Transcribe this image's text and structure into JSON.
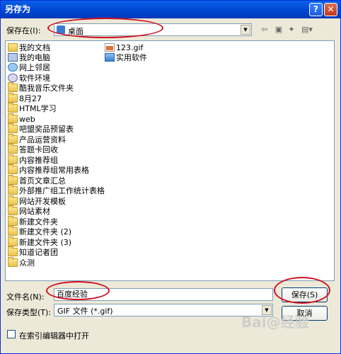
{
  "window": {
    "title": "另存为",
    "help_glyph": "?",
    "close_glyph": "✕"
  },
  "save_in": {
    "label": "保存在(I):",
    "value": "桌面"
  },
  "toolbar": {
    "back_icon": "back-arrow-icon",
    "up_icon": "up-folder-icon",
    "new_icon": "new-folder-icon",
    "views_icon": "views-menu-icon"
  },
  "files": [
    {
      "name": "我的文档",
      "icon": "documents-icon"
    },
    {
      "name": "我的电脑",
      "icon": "computer-icon"
    },
    {
      "name": "网上邻居",
      "icon": "network-icon"
    },
    {
      "name": "软件环境",
      "icon": "software-icon"
    },
    {
      "name": "酷我音乐文件夹",
      "icon": "folder-icon"
    },
    {
      "name": "8月27",
      "icon": "folder-icon"
    },
    {
      "name": "HTML学习",
      "icon": "folder-icon"
    },
    {
      "name": "web",
      "icon": "folder-icon"
    },
    {
      "name": "吧盟奖品预留表",
      "icon": "folder-icon"
    },
    {
      "name": "产品运营资料",
      "icon": "folder-icon"
    },
    {
      "name": "答题卡回收",
      "icon": "folder-icon"
    },
    {
      "name": "内容推荐组",
      "icon": "folder-icon"
    },
    {
      "name": "内容推荐组常用表格",
      "icon": "folder-icon"
    },
    {
      "name": "首页文章汇总",
      "icon": "folder-icon"
    },
    {
      "name": "外部推广组工作统计表格",
      "icon": "folder-icon"
    },
    {
      "name": "网站开发模板",
      "icon": "folder-icon"
    },
    {
      "name": "网站素材",
      "icon": "folder-icon"
    },
    {
      "name": "新建文件夹",
      "icon": "folder-icon"
    },
    {
      "name": "新建文件夹 (2)",
      "icon": "folder-icon"
    },
    {
      "name": "新建文件夹 (3)",
      "icon": "folder-icon"
    },
    {
      "name": "知道记者团",
      "icon": "folder-icon"
    },
    {
      "name": "众测",
      "icon": "folder-icon"
    },
    {
      "name": "123.gif",
      "icon": "gif-file-icon"
    },
    {
      "name": "实用软件",
      "icon": "shortcut-icon"
    }
  ],
  "filename": {
    "label": "文件名(N):",
    "value": "百度经验"
  },
  "filetype": {
    "label": "保存类型(T):",
    "value": "GIF 文件 (*.gif)"
  },
  "buttons": {
    "save": "保存(S)",
    "cancel": "取消"
  },
  "open_readonly": {
    "label": "在索引编辑器中打开"
  },
  "watermark": "Bai@经验",
  "accent_color": "#d0101f"
}
